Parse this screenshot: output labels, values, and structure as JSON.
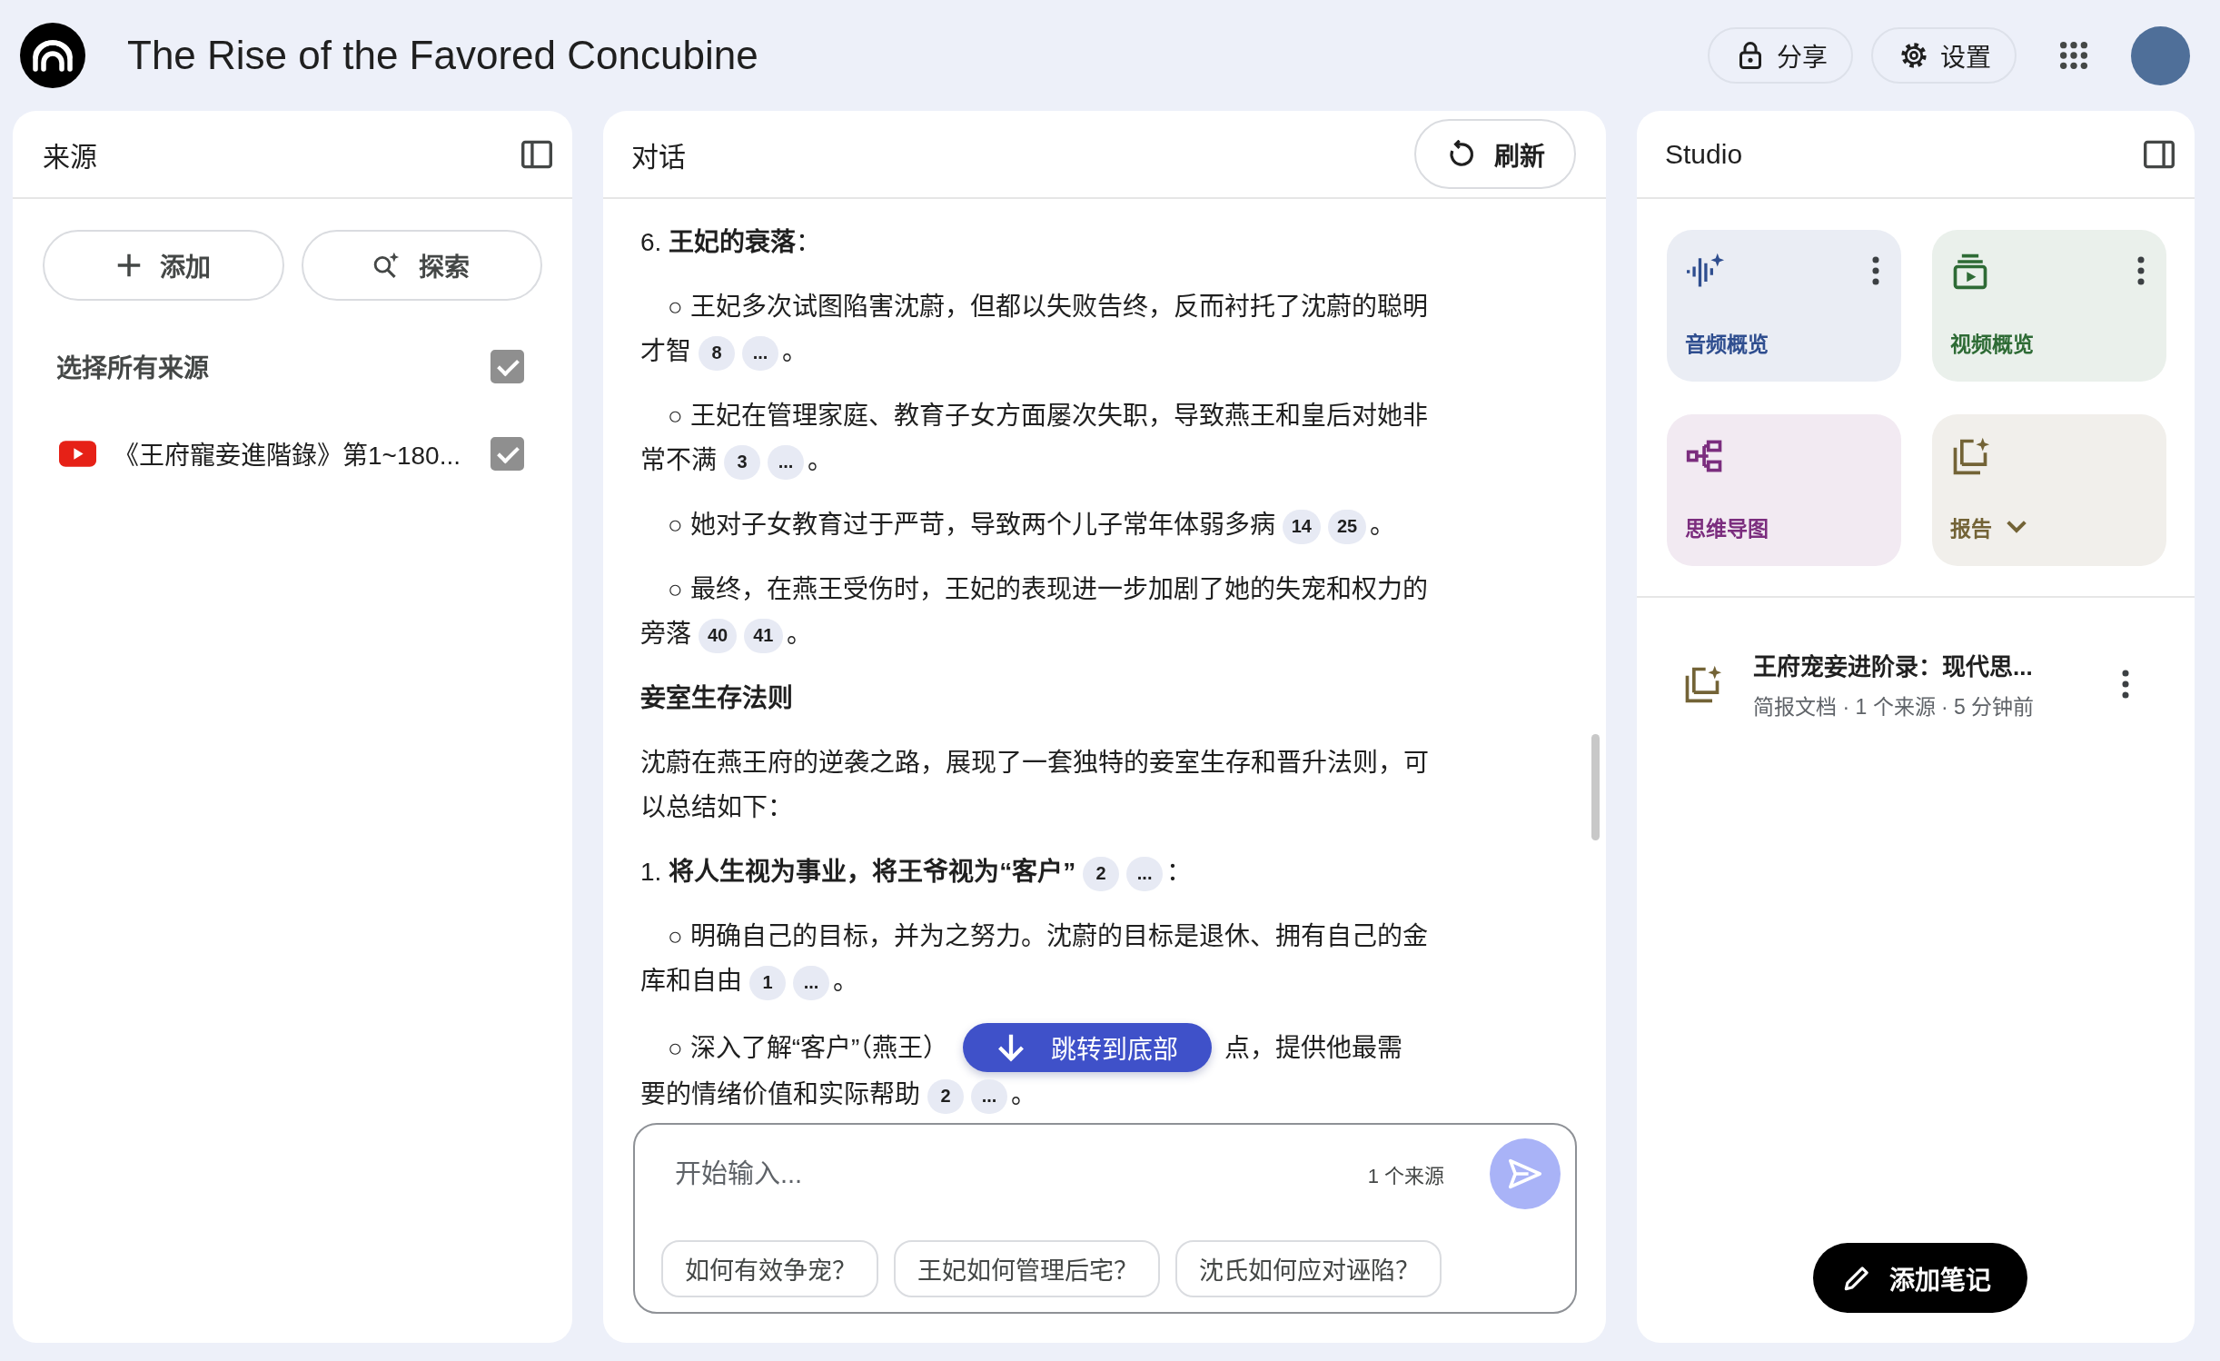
{
  "app_bar": {
    "title": "The Rise of the Favored Concubine",
    "share_button": "分享",
    "settings_button": "设置"
  },
  "sources_panel": {
    "title": "来源",
    "add_button": "添加",
    "discover_button": "探索",
    "select_all": {
      "label": "选择所有来源",
      "checked": true
    },
    "sources": [
      {
        "kind": "youtube",
        "title": "《王府寵妾進階錄》第1~180...",
        "checked": true
      }
    ]
  },
  "chat_panel": {
    "title": "对话",
    "refresh_button": "刷新",
    "messages": [
      {
        "kind": "heading",
        "text": "6. **王妃的衰落**："
      },
      {
        "kind": "bullet",
        "text": "○ 王妃多次试图陷害沈蔚，但都以失败告终，反而衬托了沈蔚的聪明才智",
        "citations": [
          "8",
          "..."
        ],
        "end": "。"
      },
      {
        "kind": "bullet",
        "text": "○ 王妃在管理家庭、教育子女方面屡次失职，导致燕王和皇后对她非常不满",
        "citations": [
          "3",
          "..."
        ],
        "end": "。"
      },
      {
        "kind": "bullet",
        "text": "○ 她对子女教育过于严苛，导致两个儿子常年体弱多病",
        "citations": [
          "14",
          "25"
        ],
        "end": "。"
      },
      {
        "kind": "bullet",
        "text": "○ 最终，在燕王受伤时，王妃的表现进一步加剧了她的失宠和权力的旁落",
        "citations": [
          "40",
          "41"
        ],
        "end": "。"
      },
      {
        "kind": "section",
        "text": "妾室生存法则"
      },
      {
        "kind": "paragraph",
        "text": "沈蔚在燕王府的逆袭之路，展现了一套独特的妾室生存和晋升法则，可以总结如下："
      },
      {
        "kind": "heading",
        "text": "1. **将人生视为事业，将王爷视为“客户”**",
        "citations": [
          "2",
          "..."
        ],
        "end": "："
      },
      {
        "kind": "bullet",
        "text": "○ 明确自己的目标，并为之努力。沈蔚的目标是退休、拥有自己的金库和自由",
        "citations": [
          "1",
          "..."
        ],
        "end": "。"
      },
      {
        "kind": "bullet",
        "text": "○ 深入了解“客户”（燕王）",
        "text_after_cover": "点，提供他最需",
        "continued": "要的情绪价值和实际帮助",
        "citations": [
          "2",
          "..."
        ],
        "end": "。"
      }
    ],
    "jump_button": "跳转到底部",
    "input": {
      "placeholder": "开始输入...",
      "source_count": "1 个来源"
    },
    "suggestions": [
      "如何有效争宠？",
      "王妃如何管理后宅？",
      "沈氏如何应对诬陷？"
    ]
  },
  "studio_panel": {
    "title": "Studio",
    "tiles": [
      {
        "kind": "audio",
        "label": "音频概览",
        "color": "#2f4e8f",
        "more_menu": true,
        "expandable": false
      },
      {
        "kind": "video",
        "label": "视频概览",
        "color": "#2e6b35",
        "more_menu": true,
        "expandable": false
      },
      {
        "kind": "mind_map",
        "label": "思维导图",
        "color": "#7b2d7e",
        "more_menu": false,
        "expandable": false
      },
      {
        "kind": "report",
        "label": "报告",
        "color": "#736336",
        "more_menu": false,
        "expandable": true
      }
    ],
    "notes": [
      {
        "kind": "report",
        "title": "王府宠妾进阶录：现代思...",
        "meta": "简报文档 · 1 个来源 · 5 分钟前"
      }
    ],
    "add_note_button": "添加笔记"
  }
}
